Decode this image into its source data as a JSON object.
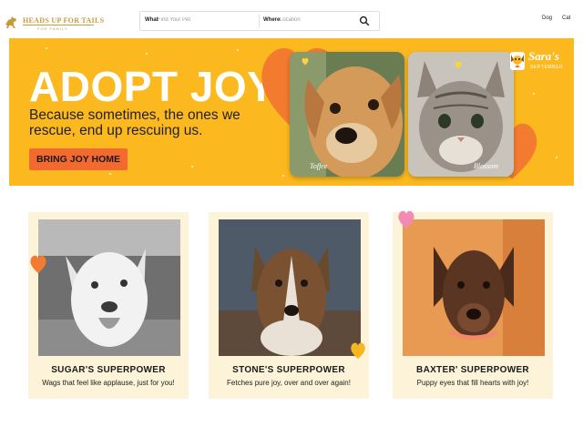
{
  "header": {
    "logo_name": "HEADS UP FOR TAILS",
    "logo_sub": "FOR FAMILY",
    "search": {
      "what_label": "What",
      "what_placeholder": "Find Your Pet",
      "where_label": "Where",
      "where_placeholder": "Location",
      "icon": "search-icon"
    },
    "nav": [
      "Dog",
      "Cat"
    ]
  },
  "banner": {
    "title": "ADOPT JOY",
    "tagline": "Because sometimes, the ones we rescue, end up rescuing us.",
    "cta": "BRING JOY HOME",
    "pets": [
      "Toffee",
      "Blossom"
    ],
    "badge_title": "Sara's",
    "badge_sub": "SEPTEMBER",
    "colors": {
      "background": "#fbb91f",
      "cta": "#f26a2f",
      "heart": "#f37b2f"
    }
  },
  "cards": [
    {
      "title": "SUGAR'S SUPERPOWER",
      "desc": "Wags that feel like applause, just for you!"
    },
    {
      "title": "STONE'S SUPERPOWER",
      "desc": "Fetches pure joy, over and over again!"
    },
    {
      "title": "BAXTER' SUPERPOWER",
      "desc": "Puppy eyes that fill hearts with joy!"
    }
  ],
  "card_colors": {
    "background": "#fdf3d9",
    "heart_orange": "#f37b2f",
    "heart_yellow": "#f7b51f",
    "heart_pink": "#f28ab4"
  }
}
